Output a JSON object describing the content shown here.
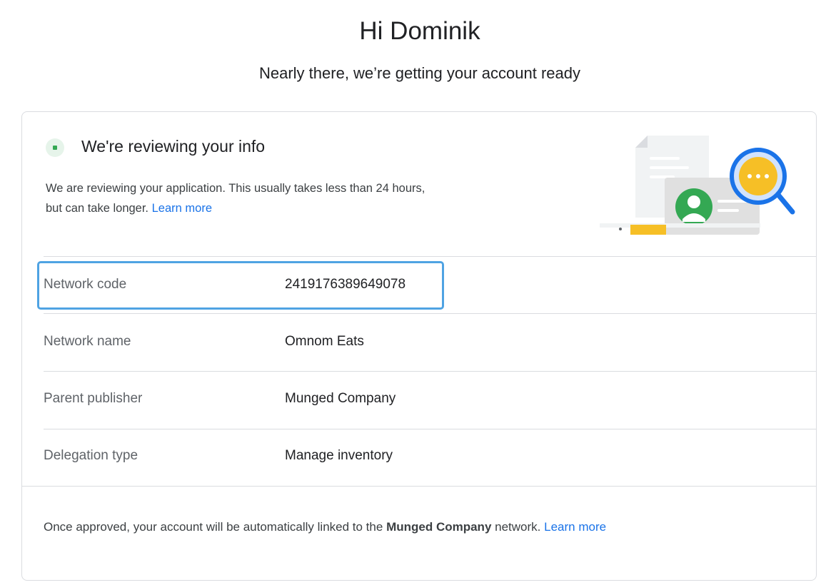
{
  "header": {
    "greeting": "Hi Dominik",
    "subtitle": "Nearly there, we’re getting your account ready"
  },
  "review": {
    "title": "We're reviewing your info",
    "description": "We are reviewing your application. This usually takes less than 24 hours,",
    "description_line2": "but can take longer.",
    "learn_more": "Learn more"
  },
  "details": [
    {
      "label": "Network code",
      "value": "2419176389649078"
    },
    {
      "label": "Network name",
      "value": "Omnom Eats"
    },
    {
      "label": "Parent publisher",
      "value": "Munged Company"
    },
    {
      "label": "Delegation type",
      "value": "Manage inventory"
    }
  ],
  "footer": {
    "text_before": "Once approved, your account will be automatically linked to the",
    "company": "Munged Company",
    "text_after": "network.",
    "learn_more": "Learn more"
  },
  "colors": {
    "status_green": "#34a853",
    "link_blue": "#1a73e8",
    "highlight_border": "#4fa3e3",
    "illustration_yellow": "#f6bf26",
    "illustration_blue": "#1a73e8"
  },
  "icons": {
    "status": "status-dot-icon",
    "illustration": "document-review-illustration"
  }
}
